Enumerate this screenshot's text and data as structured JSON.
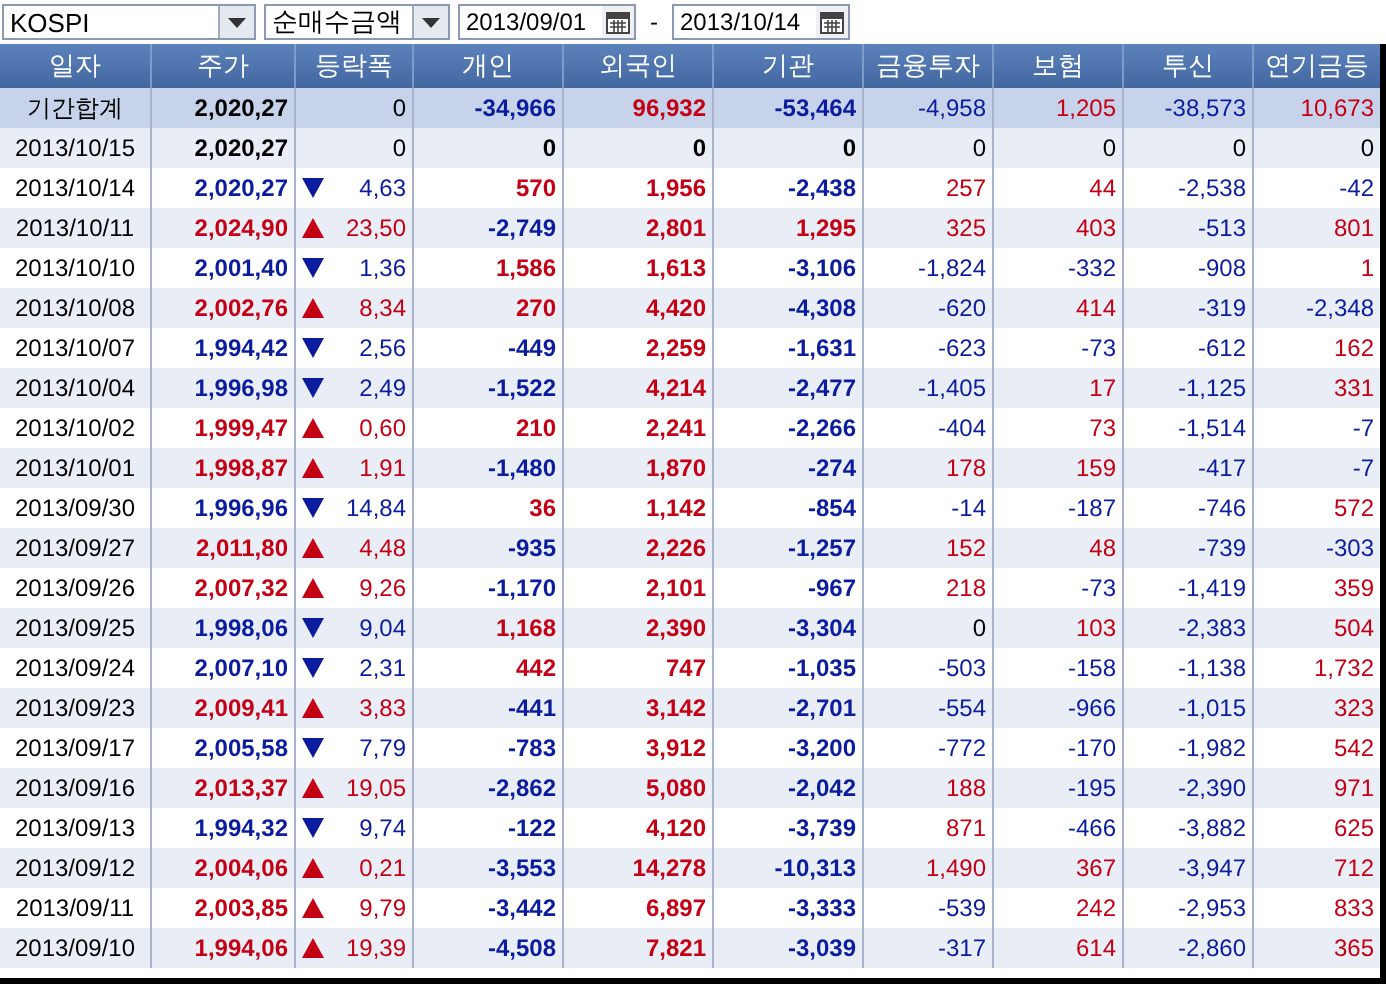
{
  "toolbar": {
    "market": "KOSPI",
    "measure": "순매수금액",
    "date_from": "2013/09/01",
    "separator": "-",
    "date_to": "2013/10/14"
  },
  "columns": [
    "일자",
    "주가",
    "등락폭",
    "개인",
    "외국인",
    "기관",
    "금융투자",
    "보험",
    "투신",
    "연기금등"
  ],
  "summary": {
    "label": "기간합계",
    "price": "2,020,27",
    "change": "0",
    "values": [
      "-34,966",
      "96,932",
      "-53,464",
      "-4,958",
      "1,205",
      "-38,573",
      "10,673"
    ]
  },
  "rows": [
    {
      "date": "2013/10/15",
      "price": "2,020,27",
      "rising": false,
      "falling": false,
      "change": "0",
      "values": [
        "0",
        "0",
        "0",
        "0",
        "0",
        "0",
        "0"
      ]
    },
    {
      "date": "2013/10/14",
      "price": "2,020,27",
      "rising": false,
      "falling": true,
      "change": "4,63",
      "values": [
        "570",
        "1,956",
        "-2,438",
        "257",
        "44",
        "-2,538",
        "-42"
      ]
    },
    {
      "date": "2013/10/11",
      "price": "2,024,90",
      "rising": true,
      "falling": false,
      "change": "23,50",
      "values": [
        "-2,749",
        "2,801",
        "1,295",
        "325",
        "403",
        "-513",
        "801"
      ]
    },
    {
      "date": "2013/10/10",
      "price": "2,001,40",
      "rising": false,
      "falling": true,
      "change": "1,36",
      "values": [
        "1,586",
        "1,613",
        "-3,106",
        "-1,824",
        "-332",
        "-908",
        "1"
      ]
    },
    {
      "date": "2013/10/08",
      "price": "2,002,76",
      "rising": true,
      "falling": false,
      "change": "8,34",
      "values": [
        "270",
        "4,420",
        "-4,308",
        "-620",
        "414",
        "-319",
        "-2,348"
      ]
    },
    {
      "date": "2013/10/07",
      "price": "1,994,42",
      "rising": false,
      "falling": true,
      "change": "2,56",
      "values": [
        "-449",
        "2,259",
        "-1,631",
        "-623",
        "-73",
        "-612",
        "162"
      ]
    },
    {
      "date": "2013/10/04",
      "price": "1,996,98",
      "rising": false,
      "falling": true,
      "change": "2,49",
      "values": [
        "-1,522",
        "4,214",
        "-2,477",
        "-1,405",
        "17",
        "-1,125",
        "331"
      ]
    },
    {
      "date": "2013/10/02",
      "price": "1,999,47",
      "rising": true,
      "falling": false,
      "change": "0,60",
      "values": [
        "210",
        "2,241",
        "-2,266",
        "-404",
        "73",
        "-1,514",
        "-7"
      ]
    },
    {
      "date": "2013/10/01",
      "price": "1,998,87",
      "rising": true,
      "falling": false,
      "change": "1,91",
      "values": [
        "-1,480",
        "1,870",
        "-274",
        "178",
        "159",
        "-417",
        "-7"
      ]
    },
    {
      "date": "2013/09/30",
      "price": "1,996,96",
      "rising": false,
      "falling": true,
      "change": "14,84",
      "values": [
        "36",
        "1,142",
        "-854",
        "-14",
        "-187",
        "-746",
        "572"
      ]
    },
    {
      "date": "2013/09/27",
      "price": "2,011,80",
      "rising": true,
      "falling": false,
      "change": "4,48",
      "values": [
        "-935",
        "2,226",
        "-1,257",
        "152",
        "48",
        "-739",
        "-303"
      ]
    },
    {
      "date": "2013/09/26",
      "price": "2,007,32",
      "rising": true,
      "falling": false,
      "change": "9,26",
      "values": [
        "-1,170",
        "2,101",
        "-967",
        "218",
        "-73",
        "-1,419",
        "359"
      ]
    },
    {
      "date": "2013/09/25",
      "price": "1,998,06",
      "rising": false,
      "falling": true,
      "change": "9,04",
      "values": [
        "1,168",
        "2,390",
        "-3,304",
        "0",
        "103",
        "-2,383",
        "504"
      ]
    },
    {
      "date": "2013/09/24",
      "price": "2,007,10",
      "rising": false,
      "falling": true,
      "change": "2,31",
      "values": [
        "442",
        "747",
        "-1,035",
        "-503",
        "-158",
        "-1,138",
        "1,732"
      ]
    },
    {
      "date": "2013/09/23",
      "price": "2,009,41",
      "rising": true,
      "falling": false,
      "change": "3,83",
      "values": [
        "-441",
        "3,142",
        "-2,701",
        "-554",
        "-966",
        "-1,015",
        "323"
      ]
    },
    {
      "date": "2013/09/17",
      "price": "2,005,58",
      "rising": false,
      "falling": true,
      "change": "7,79",
      "values": [
        "-783",
        "3,912",
        "-3,200",
        "-772",
        "-170",
        "-1,982",
        "542"
      ]
    },
    {
      "date": "2013/09/16",
      "price": "2,013,37",
      "rising": true,
      "falling": false,
      "change": "19,05",
      "values": [
        "-2,862",
        "5,080",
        "-2,042",
        "188",
        "-195",
        "-2,390",
        "971"
      ]
    },
    {
      "date": "2013/09/13",
      "price": "1,994,32",
      "rising": false,
      "falling": true,
      "change": "9,74",
      "values": [
        "-122",
        "4,120",
        "-3,739",
        "871",
        "-466",
        "-3,882",
        "625"
      ]
    },
    {
      "date": "2013/09/12",
      "price": "2,004,06",
      "rising": true,
      "falling": false,
      "change": "0,21",
      "values": [
        "-3,553",
        "14,278",
        "-10,313",
        "1,490",
        "367",
        "-3,947",
        "712"
      ]
    },
    {
      "date": "2013/09/11",
      "price": "2,003,85",
      "rising": true,
      "falling": false,
      "change": "9,79",
      "values": [
        "-3,442",
        "6,897",
        "-3,333",
        "-539",
        "242",
        "-2,953",
        "833"
      ]
    },
    {
      "date": "2013/09/10",
      "price": "1,994,06",
      "rising": true,
      "falling": false,
      "change": "19,39",
      "values": [
        "-4,508",
        "7,821",
        "-3,039",
        "-317",
        "614",
        "-2,860",
        "365"
      ]
    }
  ]
}
